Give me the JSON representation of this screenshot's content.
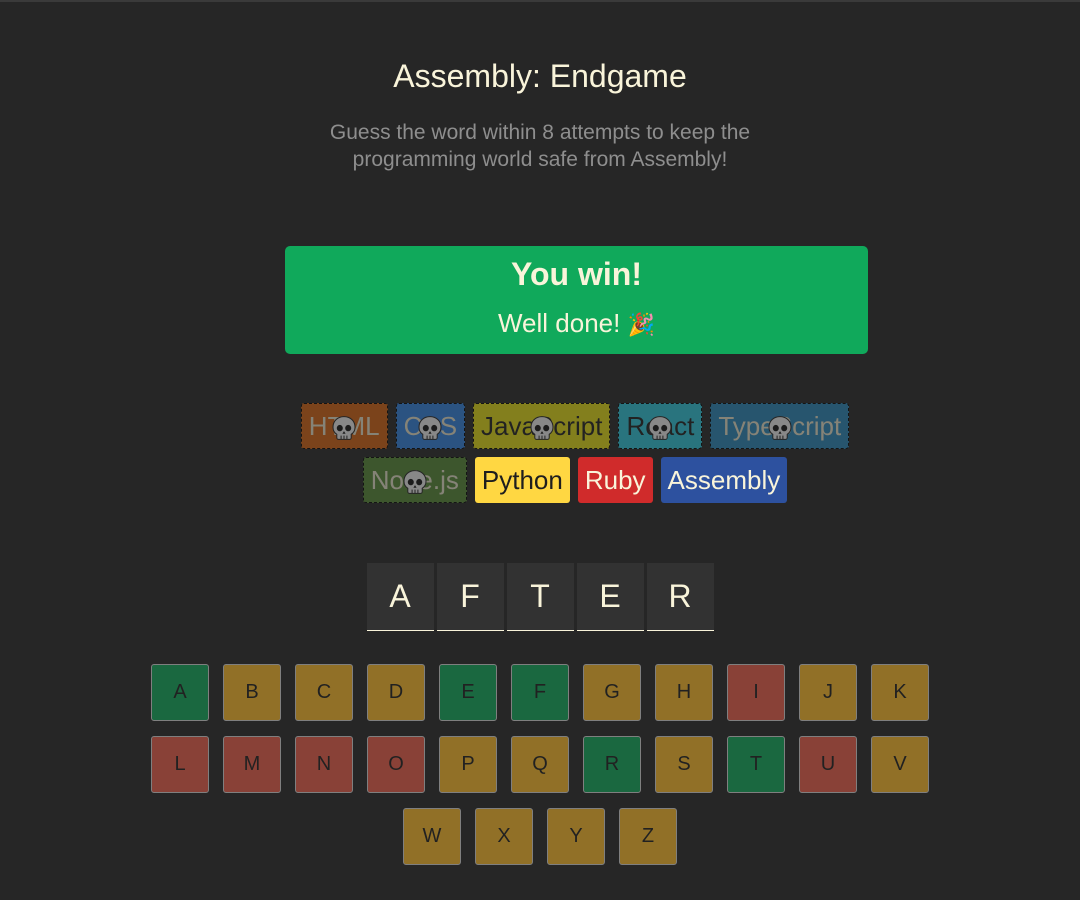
{
  "header": {
    "title": "Assembly: Endgame",
    "subtitle": "Guess the word within 8 attempts to keep the programming world safe from Assembly!"
  },
  "status": {
    "title": "You win!",
    "message": "Well done!",
    "emoji": "🎉",
    "color": "#10A95B"
  },
  "languages": [
    {
      "name": "HTML",
      "bg": "#E2680F",
      "fg": "#F9F4DA",
      "lost": true,
      "icon": "skull-icon"
    },
    {
      "name": "CSS",
      "bg": "#328AF1",
      "fg": "#F9F4DA",
      "lost": true,
      "icon": "skull-icon"
    },
    {
      "name": "JavaScript",
      "bg": "#F4EB13",
      "fg": "#1E1E1E",
      "lost": true,
      "icon": "skull-icon"
    },
    {
      "name": "React",
      "bg": "#2ED3E9",
      "fg": "#1E1E1E",
      "lost": true,
      "icon": "skull-icon"
    },
    {
      "name": "TypeScript",
      "bg": "#298EC6",
      "fg": "#F9F4DA",
      "lost": true,
      "icon": "skull-icon"
    },
    {
      "name": "Node.js",
      "bg": "#599137",
      "fg": "#F9F4DA",
      "lost": true,
      "icon": "skull-icon"
    },
    {
      "name": "Python",
      "bg": "#FFD742",
      "fg": "#1E1E1E",
      "lost": false
    },
    {
      "name": "Ruby",
      "bg": "#D02B2B",
      "fg": "#F9F4DA",
      "lost": false
    },
    {
      "name": "Assembly",
      "bg": "#2D519F",
      "fg": "#F9F4DA",
      "lost": false
    }
  ],
  "word": [
    "A",
    "F",
    "T",
    "E",
    "R"
  ],
  "keyboard": [
    {
      "letter": "A",
      "state": "correct"
    },
    {
      "letter": "B",
      "state": "unused"
    },
    {
      "letter": "C",
      "state": "unused"
    },
    {
      "letter": "D",
      "state": "unused"
    },
    {
      "letter": "E",
      "state": "correct"
    },
    {
      "letter": "F",
      "state": "correct"
    },
    {
      "letter": "G",
      "state": "unused"
    },
    {
      "letter": "H",
      "state": "unused"
    },
    {
      "letter": "I",
      "state": "wrong"
    },
    {
      "letter": "J",
      "state": "unused"
    },
    {
      "letter": "K",
      "state": "unused"
    },
    {
      "letter": "L",
      "state": "wrong"
    },
    {
      "letter": "M",
      "state": "wrong"
    },
    {
      "letter": "N",
      "state": "wrong"
    },
    {
      "letter": "O",
      "state": "wrong"
    },
    {
      "letter": "P",
      "state": "unused"
    },
    {
      "letter": "Q",
      "state": "unused"
    },
    {
      "letter": "R",
      "state": "correct"
    },
    {
      "letter": "S",
      "state": "unused"
    },
    {
      "letter": "T",
      "state": "correct"
    },
    {
      "letter": "U",
      "state": "wrong"
    },
    {
      "letter": "V",
      "state": "unused"
    },
    {
      "letter": "W",
      "state": "unused"
    },
    {
      "letter": "X",
      "state": "unused"
    },
    {
      "letter": "Y",
      "state": "unused"
    },
    {
      "letter": "Z",
      "state": "unused"
    }
  ]
}
